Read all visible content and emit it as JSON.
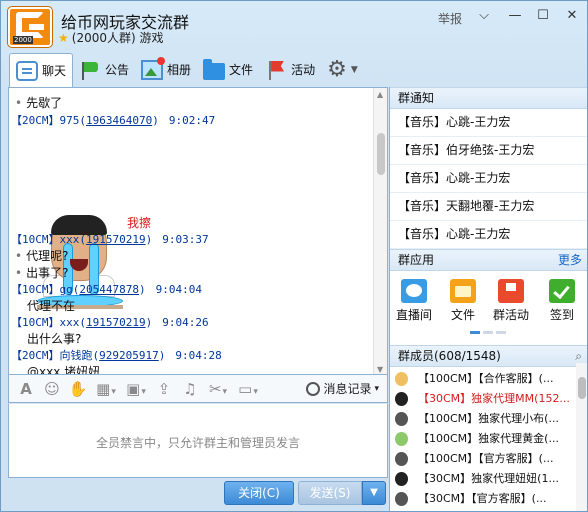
{
  "window": {
    "title": "给币网玩家交流群",
    "subtitle": "(2000人群) 游戏",
    "logo_text": "2000",
    "report_label": "举报",
    "accent": "#3d8ad6"
  },
  "tabs": [
    {
      "label": "聊天",
      "icon": "chat-icon"
    },
    {
      "label": "公告",
      "icon": "flag-icon"
    },
    {
      "label": "相册",
      "icon": "photo-icon"
    },
    {
      "label": "文件",
      "icon": "folder-icon"
    },
    {
      "label": "活动",
      "icon": "activity-flag-icon"
    }
  ],
  "chat": {
    "messages": [
      {
        "type": "text",
        "text": "先歇了"
      },
      {
        "type": "meta",
        "tag": "【20CM】975",
        "qq": "1963464070",
        "time": "9:02:47"
      },
      {
        "type": "sticker",
        "caption": "我擦"
      },
      {
        "type": "meta",
        "tag": "【10CM】xxx",
        "qq": "191570219",
        "time": "9:03:37"
      },
      {
        "type": "text",
        "text": "代理呢?"
      },
      {
        "type": "text",
        "text": "出事了?"
      },
      {
        "type": "meta",
        "tag": "【10CM】gg",
        "qq": "205447878",
        "time": "9:04:04"
      },
      {
        "type": "text",
        "text": "代理不在"
      },
      {
        "type": "meta",
        "tag": "【10CM】xxx",
        "qq": "191570219",
        "time": "9:04:26"
      },
      {
        "type": "text",
        "text": "出什么事?"
      },
      {
        "type": "meta",
        "tag": "【20CM】向钱跑",
        "qq": "929205917",
        "time": "9:04:28"
      },
      {
        "type": "text",
        "text": "@xxx 堵妞妞"
      }
    ]
  },
  "input": {
    "history_label": "消息记录",
    "notice": "全员禁言中，只允许群主和管理员发言",
    "close_label": "关闭(C)",
    "send_label": "发送(S)"
  },
  "right": {
    "notice_title": "群通知",
    "notices": [
      "【音乐】心跳-王力宏",
      "【音乐】伯牙绝弦-王力宏",
      "【音乐】心跳-王力宏",
      "【音乐】天翻地覆-王力宏",
      "【音乐】心跳-王力宏"
    ],
    "apps_title": "群应用",
    "apps_more": "更多",
    "apps": [
      {
        "label": "直播间",
        "icon": "live-icon"
      },
      {
        "label": "文件",
        "icon": "file-icon"
      },
      {
        "label": "群活动",
        "icon": "group-activity-icon"
      },
      {
        "label": "签到",
        "icon": "checkin-icon"
      }
    ],
    "members_title": "群成员(608/1548)",
    "members": [
      {
        "text": "【100CM】【合作客服】(...",
        "highlight": false
      },
      {
        "text": "【30CM】独家代理MM(152...",
        "highlight": true
      },
      {
        "text": "【100CM】独家代理小布(...",
        "highlight": false
      },
      {
        "text": "【100CM】独家代理黄金(...",
        "highlight": false
      },
      {
        "text": "【100CM】【官方客服】(...",
        "highlight": false
      },
      {
        "text": "【30CM】独家代理妞妞(1...",
        "highlight": false
      },
      {
        "text": "【30CM】【官方客服】(...",
        "highlight": false
      }
    ]
  }
}
